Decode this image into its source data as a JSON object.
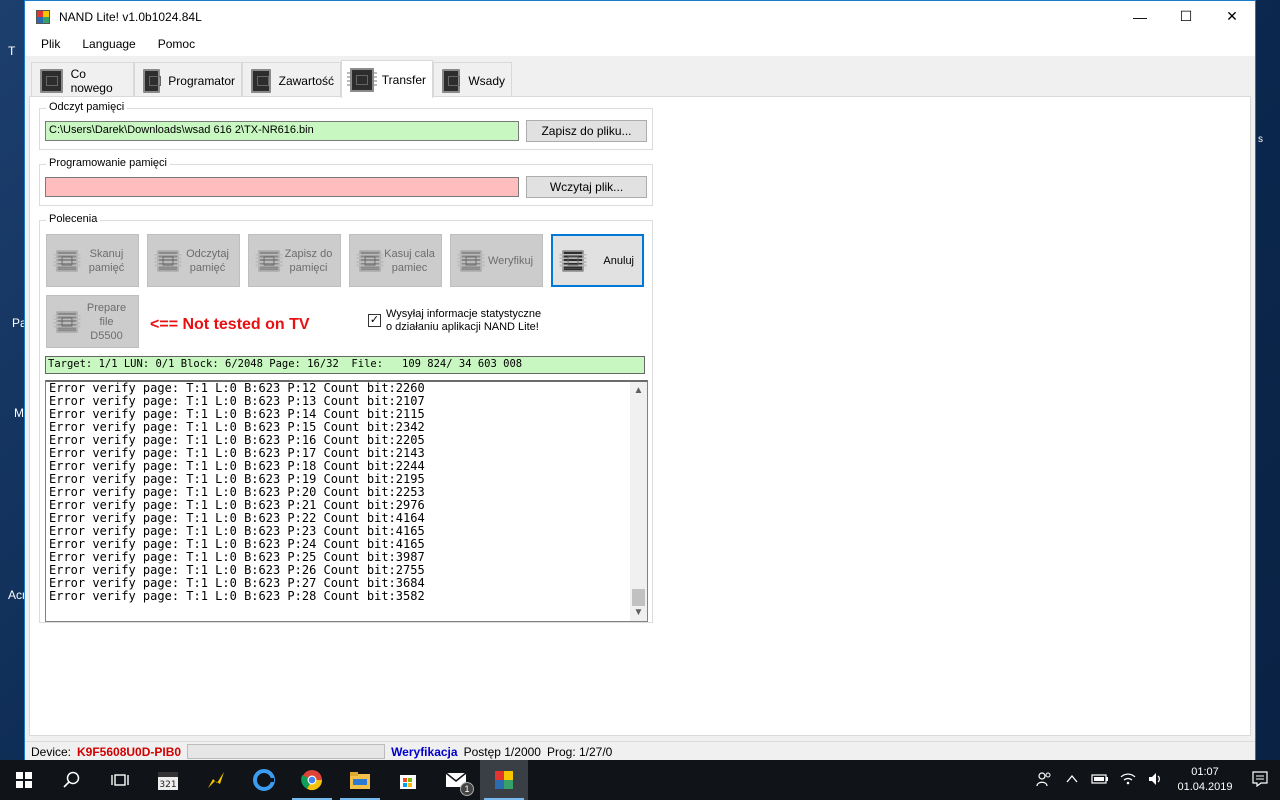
{
  "window": {
    "title": "NAND Lite! v1.0b1024.84L",
    "minimize": "—",
    "maximize": "☐",
    "close": "✕"
  },
  "menu": [
    "Plik",
    "Language",
    "Pomoc"
  ],
  "tabs": [
    {
      "label": "Co nowego",
      "active": false
    },
    {
      "label": "Programator",
      "active": false
    },
    {
      "label": "Zawartość",
      "active": false
    },
    {
      "label": "Transfer",
      "active": true
    },
    {
      "label": "Wsady",
      "active": false
    }
  ],
  "read_group": {
    "label": "Odczyt pamięci",
    "path": "C:\\Users\\Darek\\Downloads\\wsad 616  2\\TX-NR616.bin",
    "button": "Zapisz do pliku..."
  },
  "program_group": {
    "label": "Programowanie pamięci",
    "path": "",
    "button": "Wczytaj plik..."
  },
  "commands": {
    "label": "Polecenia",
    "buttons": [
      {
        "label": "Skanuj pamięć",
        "lines": [
          "Skanuj",
          "pamięć"
        ]
      },
      {
        "label": "Odczytaj pamięć",
        "lines": [
          "Odczytaj",
          "pamięć"
        ]
      },
      {
        "label": "Zapisz do pamięci",
        "lines": [
          "Zapisz do",
          "pamięci"
        ]
      },
      {
        "label": "Kasuj cala pamiec",
        "lines": [
          "Kasuj cala",
          "pamiec"
        ]
      },
      {
        "label": "Weryfikuj",
        "lines": [
          "Weryfikuj"
        ]
      },
      {
        "label": "Anuluj",
        "lines": [
          "Anuluj"
        ]
      }
    ],
    "prepare": [
      "Prepare",
      "file",
      "D5500"
    ],
    "warning": "<== Not tested on TV",
    "stats_checkbox": {
      "checked": true,
      "line1": "Wysyłaj informacje statystyczne",
      "line2": "o działaniu aplikacji NAND Lite!"
    }
  },
  "progress_line": "Target: 1/1 LUN: 0/1 Block: 6/2048 Page: 16/32  File:   109 824/ 34 603 008",
  "log": [
    "Error verify page: T:1 L:0 B:623 P:12 Count bit:2260",
    "Error verify page: T:1 L:0 B:623 P:13 Count bit:2107",
    "Error verify page: T:1 L:0 B:623 P:14 Count bit:2115",
    "Error verify page: T:1 L:0 B:623 P:15 Count bit:2342",
    "Error verify page: T:1 L:0 B:623 P:16 Count bit:2205",
    "Error verify page: T:1 L:0 B:623 P:17 Count bit:2143",
    "Error verify page: T:1 L:0 B:623 P:18 Count bit:2244",
    "Error verify page: T:1 L:0 B:623 P:19 Count bit:2195",
    "Error verify page: T:1 L:0 B:623 P:20 Count bit:2253",
    "Error verify page: T:1 L:0 B:623 P:21 Count bit:2976",
    "Error verify page: T:1 L:0 B:623 P:22 Count bit:4164",
    "Error verify page: T:1 L:0 B:623 P:23 Count bit:4165",
    "Error verify page: T:1 L:0 B:623 P:24 Count bit:4165",
    "Error verify page: T:1 L:0 B:623 P:25 Count bit:3987",
    "Error verify page: T:1 L:0 B:623 P:26 Count bit:2755",
    "Error verify page: T:1 L:0 B:623 P:27 Count bit:3684",
    "Error verify page: T:1 L:0 B:623 P:28 Count bit:3582"
  ],
  "statusbar": {
    "device_label": "Device:",
    "device_value": "K9F5608U0D-PIB0",
    "mode": "Weryfikacja",
    "progress": "Postęp 1/2000",
    "prog": "Prog: 1/27/0"
  },
  "colors": {
    "ok_field": "#c9f7c2",
    "err_field": "#ffbdbd",
    "device": "#d10000",
    "mode": "#0000cc",
    "accent": "#0078d7"
  },
  "desktop_fragments": [
    "T",
    "Pa",
    "M",
    "Acr",
    "s"
  ],
  "taskbar": {
    "icons": [
      "windows-start",
      "search",
      "task-view",
      "calendar-app",
      "sketch-app",
      "edge",
      "chrome",
      "file-explorer",
      "store",
      "mail",
      "nand-lite"
    ],
    "mail_badge": "1",
    "time": "01:07",
    "date": "01.04.2019"
  }
}
